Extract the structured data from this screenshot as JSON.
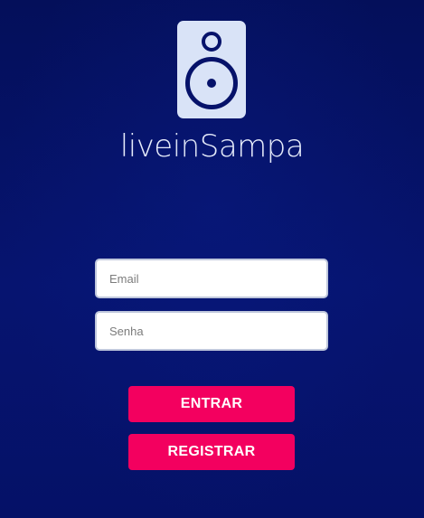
{
  "brand": {
    "name_part1": "live",
    "name_part2": "in",
    "name_part3": "Sampa",
    "logo_icon": "speaker-icon"
  },
  "form": {
    "email_placeholder": "Email",
    "email_value": "",
    "password_placeholder": "Senha",
    "password_value": ""
  },
  "buttons": {
    "login_label": "ENTRAR",
    "register_label": "REGISTRAR"
  },
  "colors": {
    "background": "#061470",
    "accent": "#f3005f",
    "logo": "#d9e3f7"
  }
}
